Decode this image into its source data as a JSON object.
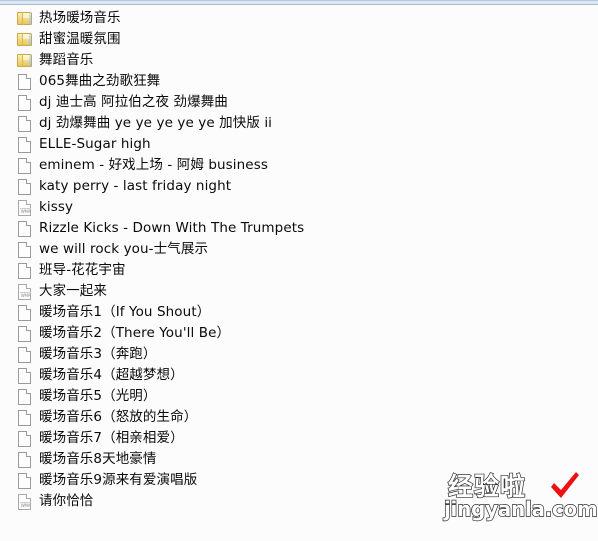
{
  "window": {
    "background_color": "#fcfcfc",
    "top_strip_color": "#dce6f2"
  },
  "file_list": {
    "items": [
      {
        "icon": "folder-icon",
        "name": "热场暖场音乐"
      },
      {
        "icon": "folder-icon",
        "name": "甜蜜温暖氛围"
      },
      {
        "icon": "folder-icon",
        "name": "舞蹈音乐"
      },
      {
        "icon": "document-icon",
        "name": "065舞曲之劲歌狂舞"
      },
      {
        "icon": "document-icon",
        "name": "dj 迪士高 阿拉伯之夜 劲爆舞曲"
      },
      {
        "icon": "document-icon",
        "name": "dj 劲爆舞曲 ye ye ye ye ye 加快版 ii"
      },
      {
        "icon": "document-icon",
        "name": "ELLE-Sugar high"
      },
      {
        "icon": "document-icon",
        "name": "eminem - 好戏上场 - 阿姆 business"
      },
      {
        "icon": "document-icon",
        "name": "katy perry - last friday night"
      },
      {
        "icon": "wma-icon",
        "name": "kissy",
        "icon_label": "WMA"
      },
      {
        "icon": "document-icon",
        "name": "Rizzle Kicks - Down With The Trumpets"
      },
      {
        "icon": "document-icon",
        "name": "we will rock you-士气展示"
      },
      {
        "icon": "document-icon",
        "name": "班导-花花宇宙"
      },
      {
        "icon": "wma-icon",
        "name": "大家一起来",
        "icon_label": "WMA"
      },
      {
        "icon": "document-icon",
        "name": "暖场音乐1（If You Shout）"
      },
      {
        "icon": "document-icon",
        "name": "暖场音乐2（There You'll Be）"
      },
      {
        "icon": "document-icon",
        "name": "暖场音乐3（奔跑）"
      },
      {
        "icon": "document-icon",
        "name": "暖场音乐4（超越梦想）"
      },
      {
        "icon": "document-icon",
        "name": "暖场音乐5（光明）"
      },
      {
        "icon": "document-icon",
        "name": "暖场音乐6（怒放的生命）"
      },
      {
        "icon": "document-icon",
        "name": "暖场音乐7（相亲相爱）"
      },
      {
        "icon": "document-icon",
        "name": "暖场音乐8天地豪情"
      },
      {
        "icon": "document-icon",
        "name": "暖场音乐9源来有爱演唱版"
      },
      {
        "icon": "wma-icon",
        "name": "请你恰恰",
        "icon_label": "WMA"
      }
    ]
  },
  "watermark": {
    "chinese_text": "经验啦",
    "url_text": "jingyanla.com",
    "check_color": "#ee1111",
    "text_color": "#ffffff",
    "outline_color": "#2b2b2b"
  }
}
